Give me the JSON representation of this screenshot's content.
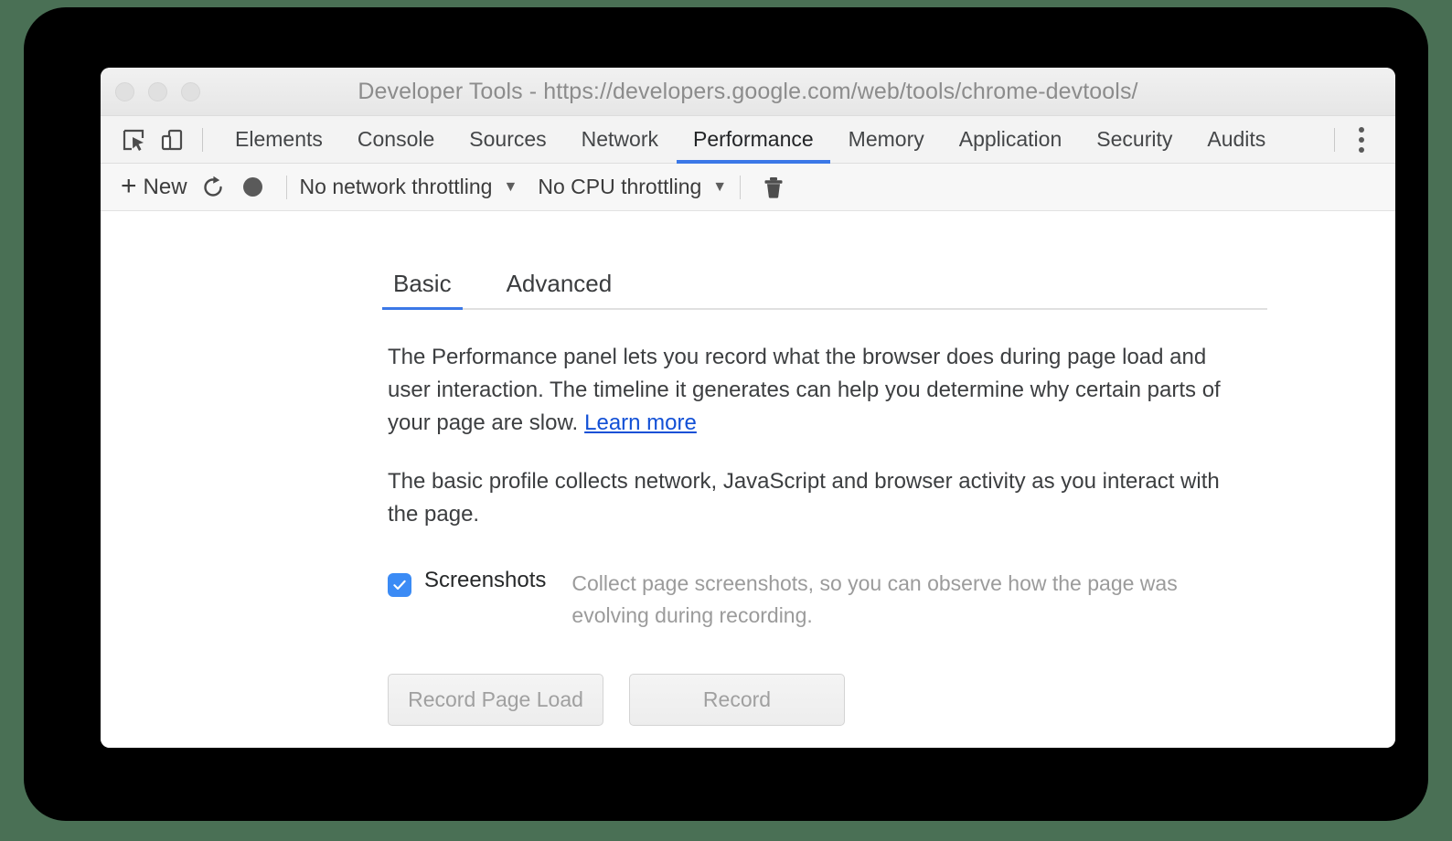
{
  "window": {
    "title": "Developer Tools - https://developers.google.com/web/tools/chrome-devtools/",
    "traffic_lights": [
      "close",
      "minimize",
      "maximize"
    ]
  },
  "tabbar": {
    "icons": [
      {
        "name": "inspect-element-icon",
        "label": "Inspect element"
      },
      {
        "name": "device-toolbar-icon",
        "label": "Toggle device toolbar"
      }
    ],
    "tabs": [
      {
        "label": "Elements",
        "active": false
      },
      {
        "label": "Console",
        "active": false
      },
      {
        "label": "Sources",
        "active": false
      },
      {
        "label": "Network",
        "active": false
      },
      {
        "label": "Performance",
        "active": true
      },
      {
        "label": "Memory",
        "active": false
      },
      {
        "label": "Application",
        "active": false
      },
      {
        "label": "Security",
        "active": false
      },
      {
        "label": "Audits",
        "active": false
      }
    ],
    "more_menu": "more-vertical-icon",
    "active_underline_color": "#3b78e7"
  },
  "perf_toolbar": {
    "new_label": "New",
    "new_icon": "plus-icon",
    "reload_icon": "reload-record-icon",
    "record_icon": "record-circle-icon",
    "network_throttling": "No network throttling",
    "cpu_throttling": "No CPU throttling",
    "caret_glyph": "▼",
    "clear_icon": "trash-icon"
  },
  "panel": {
    "subtabs": [
      {
        "label": "Basic",
        "active": true
      },
      {
        "label": "Advanced",
        "active": false
      }
    ],
    "paragraph1": "The Performance panel lets you record what the browser does during page load and user interaction. The timeline it generates can help you determine why certain parts of your page are slow.",
    "learn_more": "Learn more",
    "learn_more_color": "#1250d6",
    "paragraph2": "The basic profile collects network, JavaScript and browser activity as you interact with the page.",
    "screenshots": {
      "checked": true,
      "label": "Screenshots",
      "description": "Collect page screenshots, so you can observe how the page was evolving during recording.",
      "checkbox_color": "#3b8bf5",
      "check_glyph": "✓"
    },
    "buttons": [
      {
        "label": "Record Page Load",
        "name": "record-page-load-button"
      },
      {
        "label": "Record",
        "name": "record-button"
      }
    ]
  }
}
